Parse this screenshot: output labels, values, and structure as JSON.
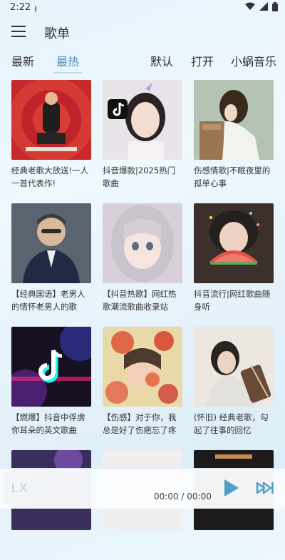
{
  "status_bar": {
    "time": "2:22",
    "download_glyph": "⭳",
    "icons": [
      "wifi-icon",
      "signal-icon",
      "battery-icon"
    ]
  },
  "header": {
    "title": "歌单"
  },
  "tabs": {
    "left": [
      {
        "label": "最新"
      },
      {
        "label": "最热",
        "active": true
      }
    ],
    "right": [
      {
        "label": "默认"
      },
      {
        "label": "打开"
      },
      {
        "label": "小蜗音乐"
      }
    ]
  },
  "playlists": [
    {
      "name": "经典老歌大放送!一人一首代表作!"
    },
    {
      "name": "抖音爆款|2025热门歌曲"
    },
    {
      "name": "伤感情歌|不眠夜里的孤单心事"
    },
    {
      "name": "【经典国语】老男人的情怀老男人的歌"
    },
    {
      "name": "【抖音热歌】网红热歌潮流歌曲收录站"
    },
    {
      "name": "抖音流行|网红歌曲随身听"
    },
    {
      "name": "【燃爆】抖音中俘虏你耳朵的英文歌曲"
    },
    {
      "name": "【伤感】对于你，我总是好了伤疤忘了疼"
    },
    {
      "name": "(怀旧) 经典老歌，勾起了往事的回忆"
    },
    {
      "name": ""
    },
    {
      "name": ""
    },
    {
      "name": ""
    }
  ],
  "player": {
    "logo_text": "LX",
    "time": "00:00 / 00:00"
  },
  "colors": {
    "accent": "#4a8fb5",
    "play": "#4f9fc8"
  }
}
